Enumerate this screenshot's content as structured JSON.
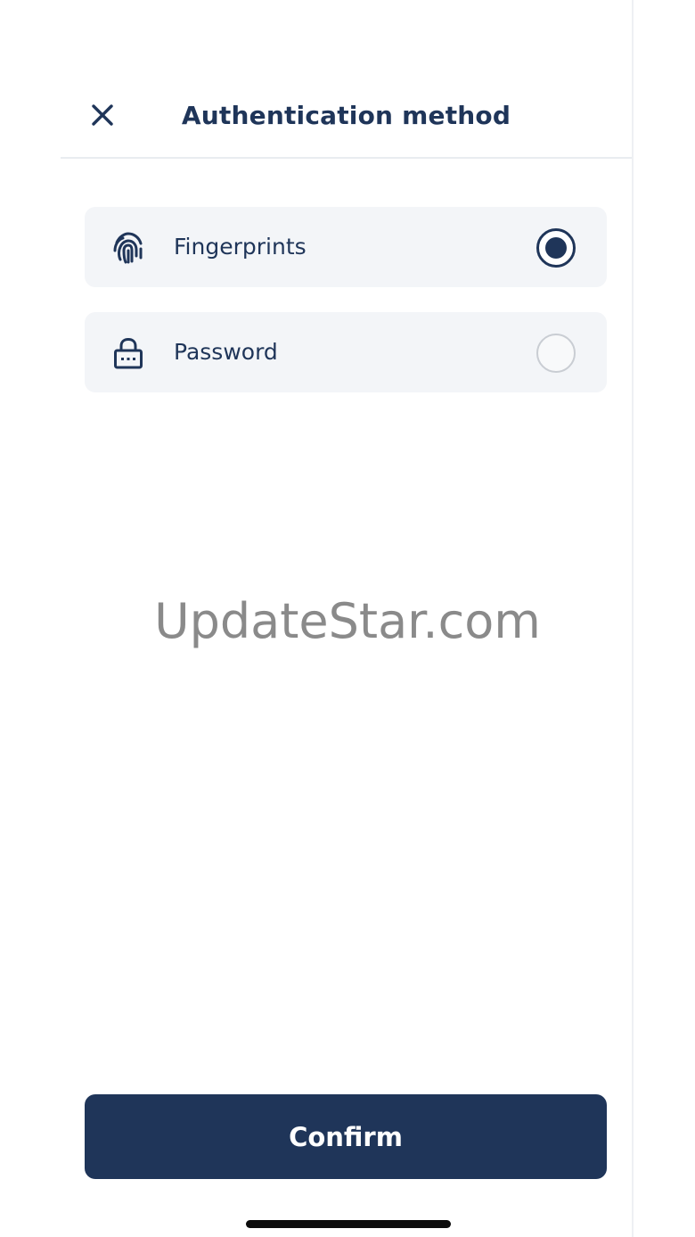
{
  "header": {
    "title": "Authentication method",
    "close_icon": "close-icon"
  },
  "options": [
    {
      "label": "Fingerprints",
      "icon": "fingerprint-icon",
      "selected": true
    },
    {
      "label": "Password",
      "icon": "lock-icon",
      "selected": false
    }
  ],
  "watermark": "UpdateStar.com",
  "confirm_label": "Confirm",
  "colors": {
    "primary": "#1f3559",
    "option_background": "#f3f5f8",
    "radio_unselected_border": "#c9cdd3"
  }
}
